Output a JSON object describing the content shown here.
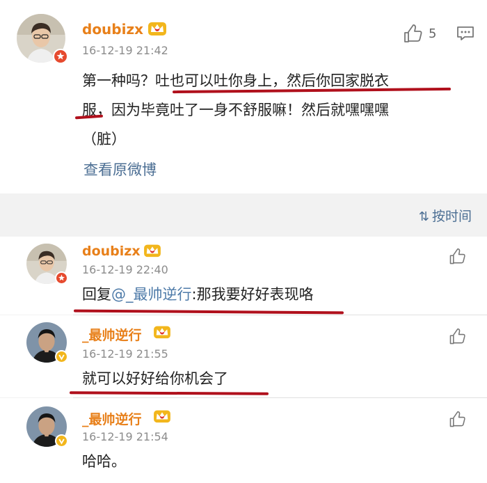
{
  "post": {
    "username": "doubizx",
    "time": "16-12-19 21:42",
    "like_count": "5",
    "text_line1": "第一种吗？吐也可以吐你身上，然后你回家脱衣",
    "text_line2": "服，因为毕竟吐了一身不舒服嘛！然后就嘿嘿嘿",
    "text_line3": "（脏）",
    "view_original": "查看原微博"
  },
  "sort": {
    "label": "按时间",
    "icon": "sort-icon"
  },
  "replies": [
    {
      "username": "doubizx",
      "time": "16-12-19 22:40",
      "prefix": "回复",
      "mention": "@_最帅逆行",
      "text": ":那我要好好表现咯"
    },
    {
      "username": "_最帅逆行",
      "time": "16-12-19 21:55",
      "text": "就可以好好给你机会了"
    },
    {
      "username": "_最帅逆行",
      "time": "16-12-19 21:54",
      "text": "哈哈。"
    }
  ],
  "colors": {
    "username": "#e8801a",
    "link": "#4d7aa8",
    "annotation": "#b0101c",
    "verified_red": "#e64a2e",
    "verified_gold": "#f2b61c"
  }
}
